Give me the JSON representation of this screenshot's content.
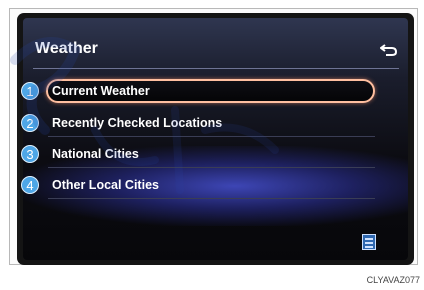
{
  "screen": {
    "title": "Weather",
    "menu": [
      {
        "number": "1",
        "label": "Current Weather",
        "selected": true
      },
      {
        "number": "2",
        "label": "Recently Checked Locations",
        "selected": false
      },
      {
        "number": "3",
        "label": "National Cities",
        "selected": false
      },
      {
        "number": "4",
        "label": "Other Local Cities",
        "selected": false
      }
    ]
  },
  "figure_code": "CLYAVAZ077",
  "colors": {
    "badge": "#4ea6e6",
    "selection_outline": "#ffbfa0",
    "screen_top": "#2f3650",
    "glow": "#4650d2"
  },
  "icons": {
    "back": "back-arrow-icon",
    "logo": "weather-provider-logo-icon"
  }
}
